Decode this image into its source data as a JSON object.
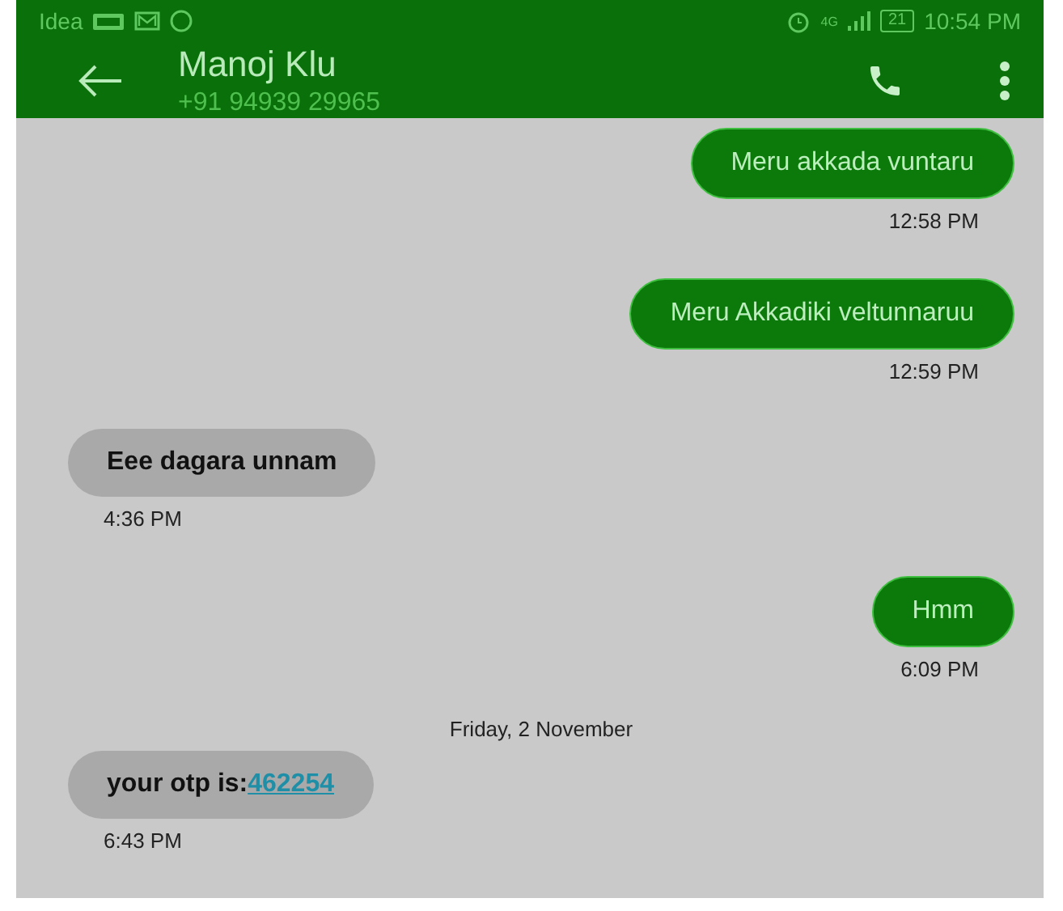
{
  "status_bar": {
    "carrier": "Idea",
    "network": "4G",
    "battery": "21",
    "time": "10:54 PM"
  },
  "header": {
    "name": "Manoj Klu",
    "number": "+91 94939 29965"
  },
  "messages": [
    {
      "kind": "sent",
      "text": "Meru akkada vuntaru",
      "time": "12:58 PM"
    },
    {
      "kind": "sent",
      "text": "Meru Akkadiki veltunnaruu",
      "time": "12:59 PM"
    },
    {
      "kind": "received",
      "text": "Eee dagara unnam",
      "time": "4:36 PM"
    },
    {
      "kind": "sent",
      "text": "Hmm",
      "time": "6:09 PM"
    },
    {
      "kind": "date",
      "text": "Friday, 2 November"
    },
    {
      "kind": "received",
      "text": "your otp is:",
      "link": "462254",
      "time": "6:43 PM"
    }
  ]
}
